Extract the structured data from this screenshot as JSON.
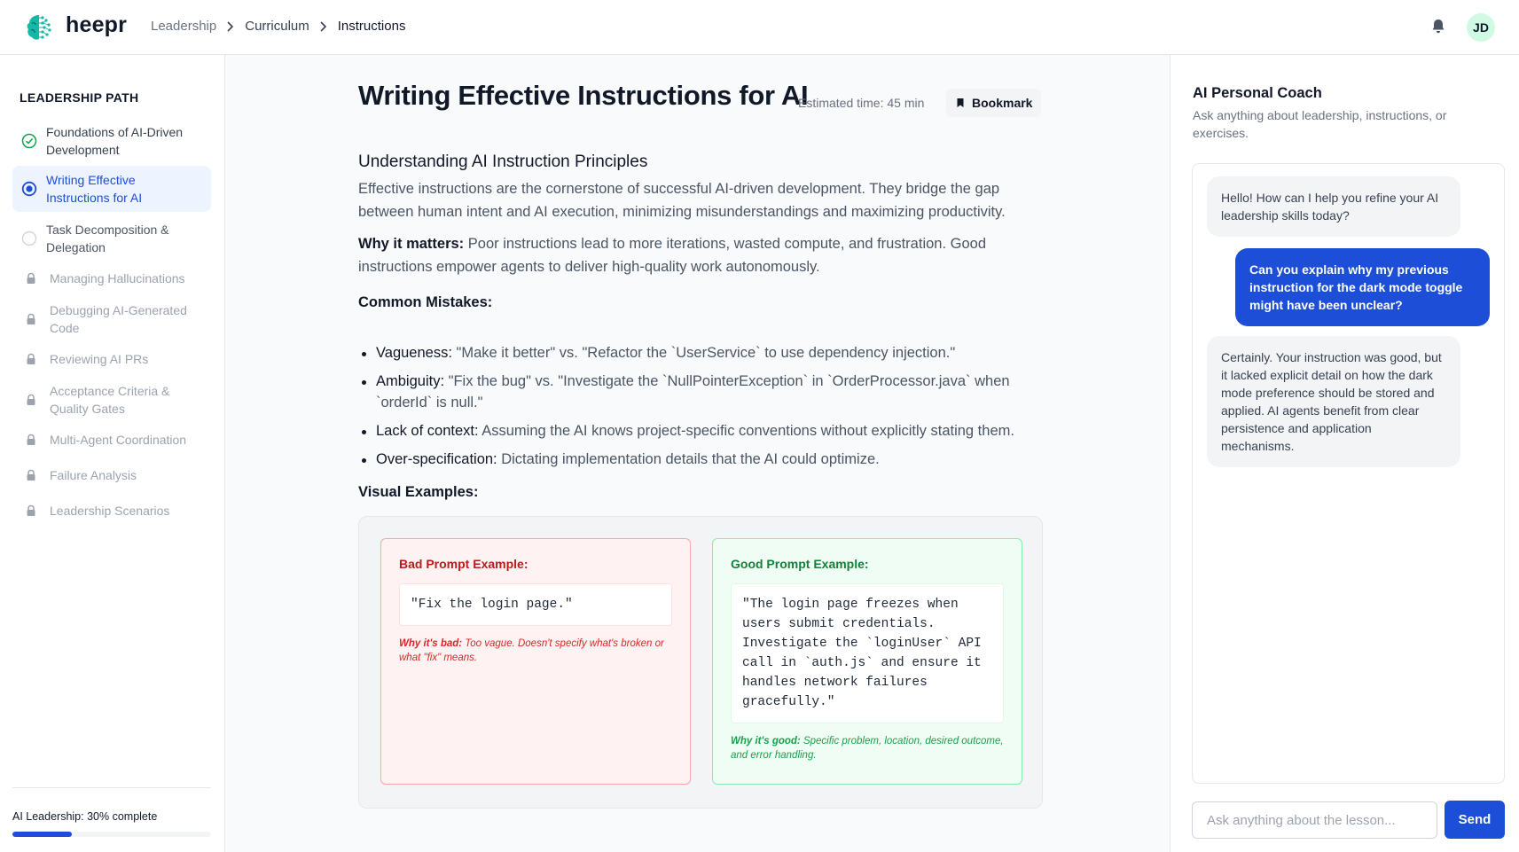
{
  "header": {
    "brand": "heepr",
    "breadcrumb": [
      "Leadership",
      "Curriculum",
      "Instructions"
    ],
    "avatar_initials": "JD"
  },
  "sidebar": {
    "title": "LEADERSHIP PATH",
    "items": [
      {
        "label": "Foundations of AI-Driven Development",
        "status": "completed",
        "icon": "check-circle-icon"
      },
      {
        "label": "Writing Effective Instructions for AI",
        "status": "current",
        "icon": "radio-dot-icon"
      },
      {
        "label": "Task Decomposition & Delegation",
        "status": "available",
        "icon": "empty-circle-icon"
      },
      {
        "label": "Managing Hallucinations",
        "status": "locked",
        "icon": "lock-icon"
      },
      {
        "label": "Debugging AI-Generated Code",
        "status": "locked",
        "icon": "lock-icon"
      },
      {
        "label": "Reviewing AI PRs",
        "status": "locked",
        "icon": "lock-icon"
      },
      {
        "label": "Acceptance Criteria & Quality Gates",
        "status": "locked",
        "icon": "lock-icon"
      },
      {
        "label": "Multi-Agent Coordination",
        "status": "locked",
        "icon": "lock-icon"
      },
      {
        "label": "Failure Analysis",
        "status": "locked",
        "icon": "lock-icon"
      },
      {
        "label": "Leadership Scenarios",
        "status": "locked",
        "icon": "lock-icon"
      }
    ],
    "progress_label": "AI Leadership: 30% complete",
    "progress_value": 0.3
  },
  "lesson": {
    "title": "Writing Effective Instructions for AI",
    "estimated_time": "Estimated time: 45 min",
    "bookmark_label": "Bookmark",
    "section_title": "Understanding AI Instruction Principles",
    "intro": "Effective instructions are the cornerstone of successful AI-driven development. They bridge the gap between human intent and AI execution, minimizing misunderstandings and maximizing productivity.",
    "why_label": "Why it matters:",
    "why_text": " Poor instructions lead to more iterations, wasted compute, and frustration. Good instructions empower agents to deliver high-quality work autonomously.",
    "mistakes_title": "Common Mistakes:",
    "mistakes": [
      {
        "term": "Vagueness:",
        "text": " \"Make it better\" vs. \"Refactor the `UserService` to use dependency injection.\""
      },
      {
        "term": "Ambiguity:",
        "text": " \"Fix the bug\" vs. \"Investigate the `NullPointerException` in `OrderProcessor.java` when `orderId` is null.\""
      },
      {
        "term": "Lack of context:",
        "text": " Assuming the AI knows project-specific conventions without explicitly stating them."
      },
      {
        "term": "Over-specification:",
        "text": " Dictating implementation details that the AI could optimize."
      }
    ],
    "examples_title": "Visual Examples:",
    "bad_example": {
      "title": "Bad Prompt Example:",
      "code": "\"Fix the login page.\"",
      "why_label": "Why it's bad:",
      "why_text": " Too vague. Doesn't specify what's broken or what \"fix\" means."
    },
    "good_example": {
      "title": "Good Prompt Example:",
      "code": "\"The login page freezes when users submit credentials. Investigate the `loginUser` API call in `auth.js` and ensure it handles network failures gracefully.\"",
      "why_label": "Why it's good:",
      "why_text": " Specific problem, location, desired outcome, and error handling."
    }
  },
  "coach": {
    "title": "AI Personal Coach",
    "subtitle": "Ask anything about leadership, instructions, or exercises.",
    "messages": [
      {
        "role": "assistant",
        "text": "Hello! How can I help you refine your AI leadership skills today?"
      },
      {
        "role": "user",
        "text": "Can you explain why my previous instruction for the dark mode toggle might have been unclear?"
      },
      {
        "role": "assistant",
        "text": "Certainly. Your instruction was good, but it lacked explicit detail on how the dark mode preference should be stored and applied. AI agents benefit from clear persistence and application mechanisms."
      }
    ],
    "input_placeholder": "Ask anything about the lesson...",
    "send_label": "Send"
  },
  "colors": {
    "accent": "#1d4ed8",
    "accent_light": "#eef4ff",
    "success": "#16a34a",
    "danger": "#dc2626",
    "brand_teal": "#14b8a6"
  }
}
